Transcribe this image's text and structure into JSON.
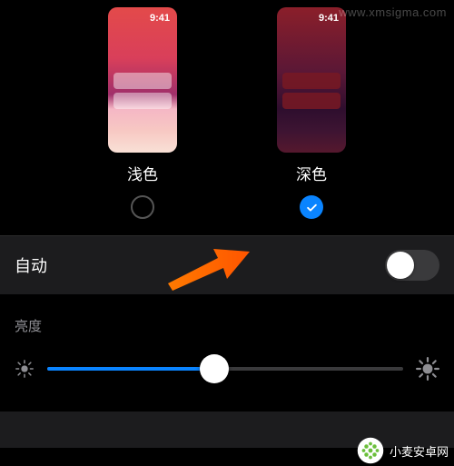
{
  "themes": {
    "time": "9:41",
    "light": {
      "label": "浅色",
      "selected": false
    },
    "dark": {
      "label": "深色",
      "selected": true
    }
  },
  "auto": {
    "label": "自动",
    "value": false
  },
  "brightness": {
    "title": "亮度",
    "value": 47
  },
  "watermark": {
    "brand": "小麦安卓网",
    "url": "www.xmsigma.com"
  }
}
